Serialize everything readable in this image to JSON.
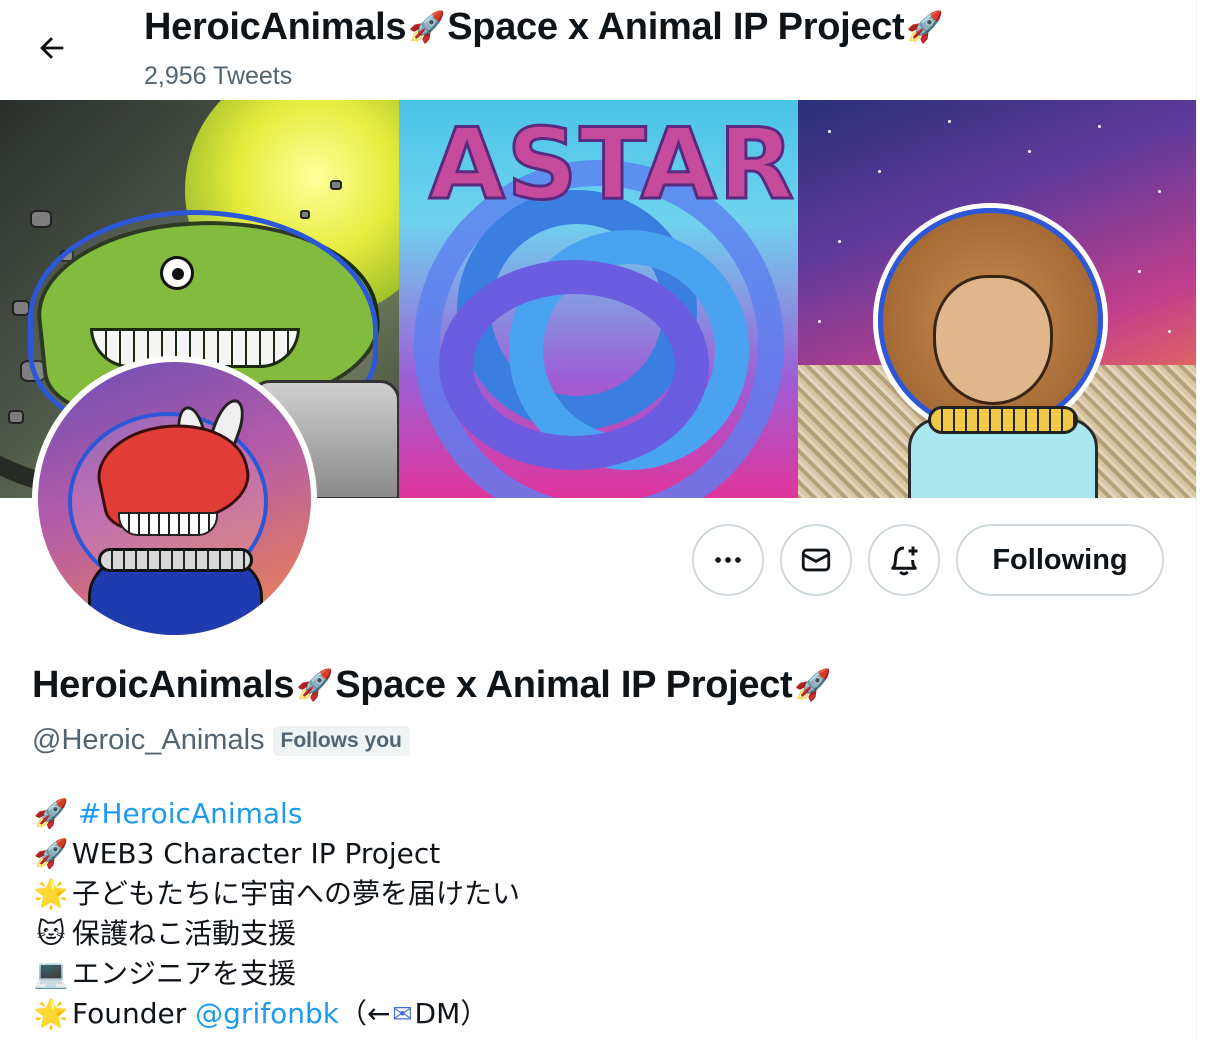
{
  "header": {
    "back_icon": "arrow-left-icon",
    "title_part1": "HeroicAnimals",
    "title_part2": "Space x Animal IP Project",
    "rocket": "🚀",
    "tweet_count": "2,956 Tweets"
  },
  "banner": {
    "panel_center_text": "ASTAR"
  },
  "actions": {
    "more_icon": "more-icon",
    "message_icon": "mail-icon",
    "notify_icon": "bell-plus-icon",
    "following_label": "Following"
  },
  "profile": {
    "name_part1": "HeroicAnimals",
    "name_part2": "Space x Animal IP Project",
    "rocket": "🚀",
    "handle": "@Heroic_Animals",
    "follows_you": "Follows you"
  },
  "bio": {
    "line1_emoji": "🚀",
    "line1_hashtag": "#HeroicAnimals",
    "line2_emoji": "🚀",
    "line2_text": "WEB3 Character IP Project",
    "line3_emoji": "🌟",
    "line3_text": "子どもたちに宇宙への夢を届けたい",
    "line4_emoji": "🐱",
    "line4_text": "保護ねこ活動支援",
    "line5_emoji": "💻",
    "line5_text": "エンジニアを支援",
    "line6_emoji": "🌟",
    "line6_text_before": "Founder ",
    "line6_mention": "@grifonbk",
    "line6_text_after1": "（←",
    "line6_mail": "✉",
    "line6_text_after2": "DM）"
  },
  "colors": {
    "link": "#1d9bf0",
    "secondary_text": "#536471",
    "border": "#cfd9de"
  }
}
